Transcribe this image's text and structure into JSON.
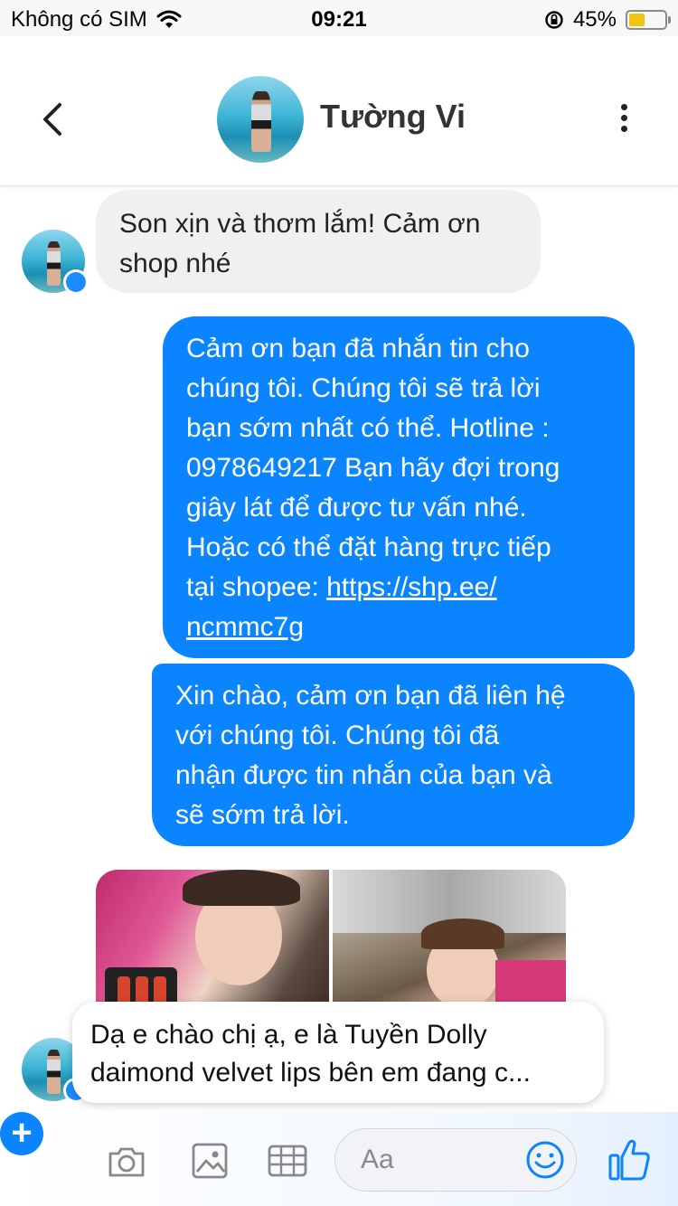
{
  "status_bar": {
    "carrier": "Không có SIM",
    "time": "09:21",
    "battery_percent": "45%",
    "battery_level": 0.45,
    "battery_color": "#f2c40f"
  },
  "header": {
    "contact_name": "Tường Vi"
  },
  "messages": [
    {
      "from": "contact",
      "lines": [
        "Son xịn và thơm lắm! Cảm ơn",
        "shop nhé"
      ]
    },
    {
      "from": "me",
      "lines": [
        "Cảm ơn bạn đã nhắn tin cho",
        "chúng tôi. Chúng tôi sẽ trả lời",
        "bạn sớm nhất có thể. Hotline :",
        "0978649217 Bạn hãy đợi trong",
        "giây lát để được tư vấn nhé.",
        "Hoặc có thể đặt hàng trực tiếp"
      ],
      "link_prefix": "tại shopee: ",
      "link_part1": "https://shp.ee/",
      "link_part2": "ncmmc7g"
    },
    {
      "from": "me",
      "lines": [
        "Xin chào, cảm ơn bạn đã liên hệ",
        "với chúng tôi. Chúng tôi đã",
        "nhận được tin nhắn của bạn và",
        "sẽ sớm trả lời."
      ]
    }
  ],
  "preview": {
    "lines": [
      "Dạ e chào chị ạ, e là Tuyền Dolly",
      "daimond velvet lips bên em đang c..."
    ]
  },
  "composer": {
    "placeholder": "Aa"
  },
  "colors": {
    "accent": "#0a84ff",
    "incoming_bubble": "#f0f0f0"
  }
}
